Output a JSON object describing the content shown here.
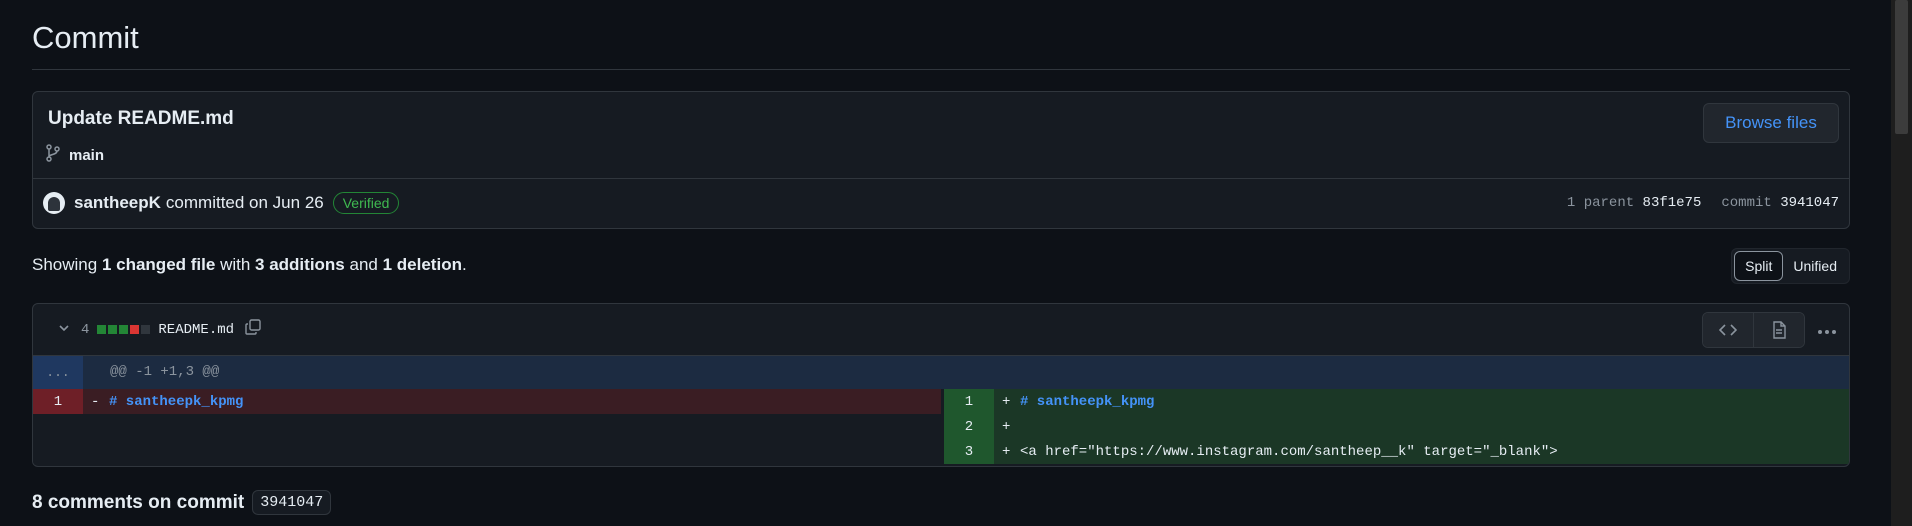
{
  "page": {
    "title": "Commit"
  },
  "commit": {
    "message": "Update README.md",
    "branch": "main",
    "browse_label": "Browse files",
    "author": "santheepK",
    "committed_text": "committed on Jun 26",
    "verified_label": "Verified",
    "parent_label": "1 parent",
    "parent_sha": "83f1e75",
    "commit_label": "commit",
    "commit_sha": "3941047"
  },
  "summary": {
    "prefix": "Showing",
    "files": "1 changed file",
    "with": "with",
    "additions": "3 additions",
    "and": "and",
    "deletions": "1 deletion",
    "suffix": "."
  },
  "view_toggle": {
    "split": "Split",
    "unified": "Unified",
    "active": "Split"
  },
  "file": {
    "change_count": "4",
    "name": "README.md",
    "diffstat": [
      "add",
      "add",
      "add",
      "del",
      "neutral"
    ],
    "hunk_header": "@@ -1 +1,3 @@",
    "expand_label": "...",
    "left_lines": [
      {
        "num": "1",
        "sign": "-",
        "text": "# santheepk_kpmg"
      }
    ],
    "right_lines": [
      {
        "num": "1",
        "sign": "+",
        "text": "# santheepk_kpmg"
      },
      {
        "num": "2",
        "sign": "+",
        "text": ""
      },
      {
        "num": "3",
        "sign": "+",
        "text": "<a href=\"https://www.instagram.com/santheep__k\" target=\"_blank\">"
      }
    ]
  },
  "comments": {
    "heading": "8 comments on commit",
    "sha": "3941047"
  },
  "colors": {
    "link": "#4493f8",
    "verified": "#3fb950",
    "addition": "#238636",
    "deletion": "#da3633"
  }
}
